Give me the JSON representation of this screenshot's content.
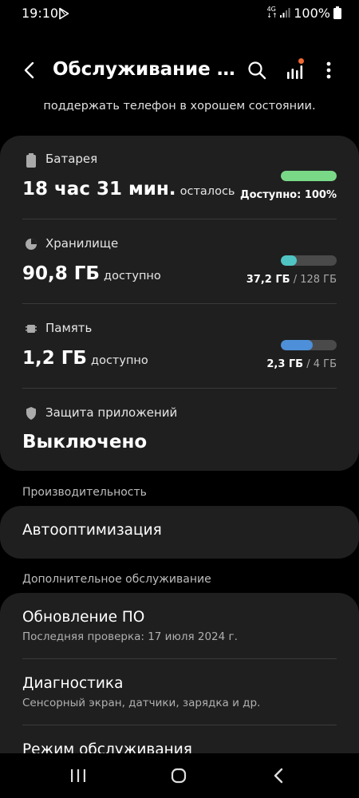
{
  "status_bar": {
    "time": "19:10",
    "network_top": "4G",
    "network_bottom": "↓↑",
    "battery_text": "100%"
  },
  "app_bar": {
    "title": "Обслуживание устройства",
    "icons": [
      "back-icon",
      "search-icon",
      "stats-icon",
      "more-icon"
    ]
  },
  "subtitle": "поддержать телефон в хорошем состоянии.",
  "main_card": {
    "battery": {
      "label": "Батарея",
      "value_big": "18 час 31 мин.",
      "value_small": "осталось",
      "right_text": "Доступно: 100%",
      "level": 1.0,
      "color": "#7ad987"
    },
    "storage": {
      "label": "Хранилище",
      "value_big": "90,8 ГБ",
      "value_small": "доступно",
      "used": "37,2 ГБ",
      "total": "/ 128 ГБ",
      "level": 0.29,
      "color": "#4fc4c2"
    },
    "memory": {
      "label": "Память",
      "value_big": "1,2 ГБ",
      "value_small": "доступно",
      "used": "2,3 ГБ",
      "total": "/ 4 ГБ",
      "level": 0.575,
      "color": "#4d8fd8"
    },
    "app_protection": {
      "label": "Защита приложений",
      "value_big": "Выключено"
    }
  },
  "performance": {
    "header": "Производительность",
    "item": "Автооптимизация"
  },
  "additional": {
    "header": "Дополнительное обслуживание",
    "items": [
      {
        "title": "Обновление ПО",
        "subtitle": "Последняя проверка: 17 июля 2024 г."
      },
      {
        "title": "Диагностика",
        "subtitle": "Сенсорный экран, датчики, зарядка и др."
      },
      {
        "title": "Режим обслуживания"
      }
    ]
  }
}
